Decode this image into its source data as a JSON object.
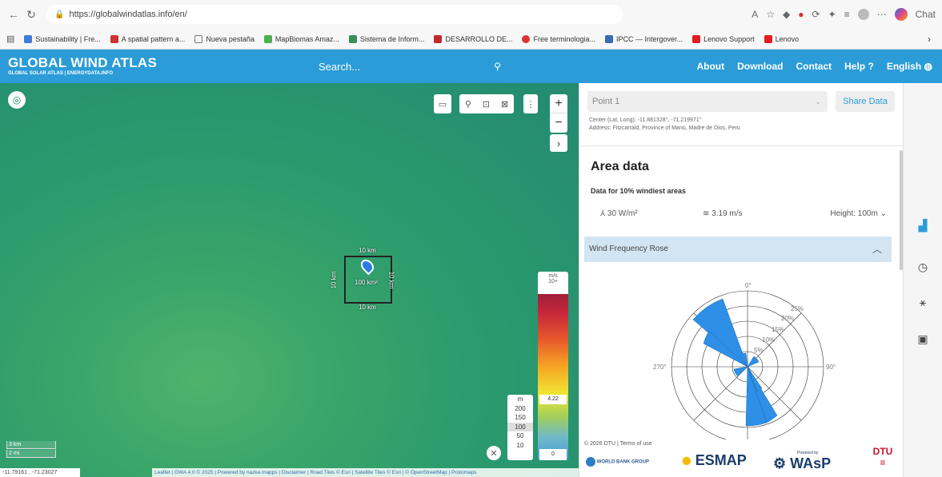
{
  "browser": {
    "url": "https://globalwindatlas.info/en/",
    "chat_label": "Chat",
    "bookmarks": [
      {
        "label": "Sustainability | Fre..."
      },
      {
        "label": "A spatial pattern a..."
      },
      {
        "label": "Nueva pestaña"
      },
      {
        "label": "MapBiomas Amaz..."
      },
      {
        "label": "Sistema de Inform..."
      },
      {
        "label": "DESARROLLO DE..."
      },
      {
        "label": "Free terminologia..."
      },
      {
        "label": "IPCC — Intergover..."
      },
      {
        "label": "Lenovo Support"
      },
      {
        "label": "Lenovo"
      }
    ]
  },
  "header": {
    "title": "GLOBAL WIND ATLAS",
    "subtitle": "GLOBAL SOLAR ATLAS | ENERGYDATA.INFO",
    "search_placeholder": "Search...",
    "menu": [
      "About",
      "Download",
      "Contact",
      "Help",
      "English"
    ],
    "brand_color": "#2b9cd8"
  },
  "map": {
    "bbox_top": "10 km",
    "bbox_bottom": "10 km",
    "bbox_left": "10 km",
    "bbox_right": "10 km",
    "bbox_area": "100 km²",
    "legend_ms": {
      "unit": "m/s",
      "top": "10+",
      "marker": "4.22",
      "bottom": "0"
    },
    "legend_m": {
      "unit": "m",
      "values": [
        "200",
        "150",
        "100",
        "50",
        "10"
      ]
    },
    "scale_km": "3 km",
    "scale_mi": "2 mi",
    "coords": "-11.79161 , -71.23027",
    "attribution": "Leaflet | GWA 4.0 © 2025 | Powered by nazka mapps | Disclaimer | Road Tiles © Esri | Satellite Tiles © Esri | © OpenStreetMap | Protomaps"
  },
  "panel": {
    "point_label": "Point 1",
    "share_label": "Share Data",
    "center_line": "Center (Lat, Long): -11.881328°, -71.219971°",
    "address_line": "Address: Fitzcarrald, Province of Manú, Madre de Dios, Peru",
    "area_title": "Area data",
    "area_sub": "Data for 10% windiest areas",
    "power": "30 W/m²",
    "speed": "3.19 m/s",
    "height": "Height: 100m",
    "rose_title": "Wind Frequency Rose",
    "rose_labels": {
      "n": "0°",
      "e": "90°",
      "w": "270°",
      "r25": "25%",
      "r20": "20%",
      "r15": "15%",
      "r10": "10%",
      "r5": "5%"
    },
    "copyright": "© 2026 DTU | Terms of use",
    "brands": {
      "wb": "WORLD BANK GROUP",
      "esmap": "ESMAP",
      "wasp_small": "Powered by",
      "wasp": "WAsP",
      "dtu": "DTU"
    }
  }
}
